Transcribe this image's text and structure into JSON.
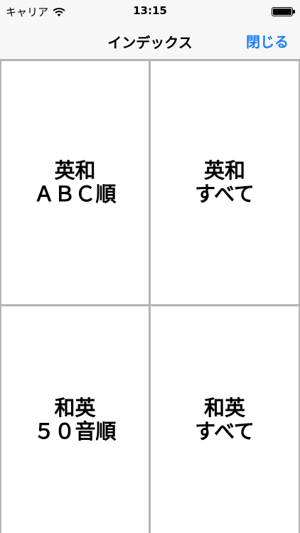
{
  "status_bar": {
    "carrier": "キャリア",
    "time": "13:15",
    "battery_level": 1.0
  },
  "nav": {
    "title": "インデックス",
    "close_label": "閉じる"
  },
  "grid": {
    "cells": [
      {
        "line1": "英和",
        "line2": "ＡＢＣ順"
      },
      {
        "line1": "英和",
        "line2": "すべて"
      },
      {
        "line1": "和英",
        "line2": "５０音順"
      },
      {
        "line1": "和英",
        "line2": "すべて"
      }
    ]
  },
  "colors": {
    "accent": "#1a7cf5",
    "bar_background": "#f7f7f7",
    "grid_line": "#b4b4b4"
  },
  "icons": {
    "wifi": "wifi-icon",
    "battery": "battery-icon"
  }
}
